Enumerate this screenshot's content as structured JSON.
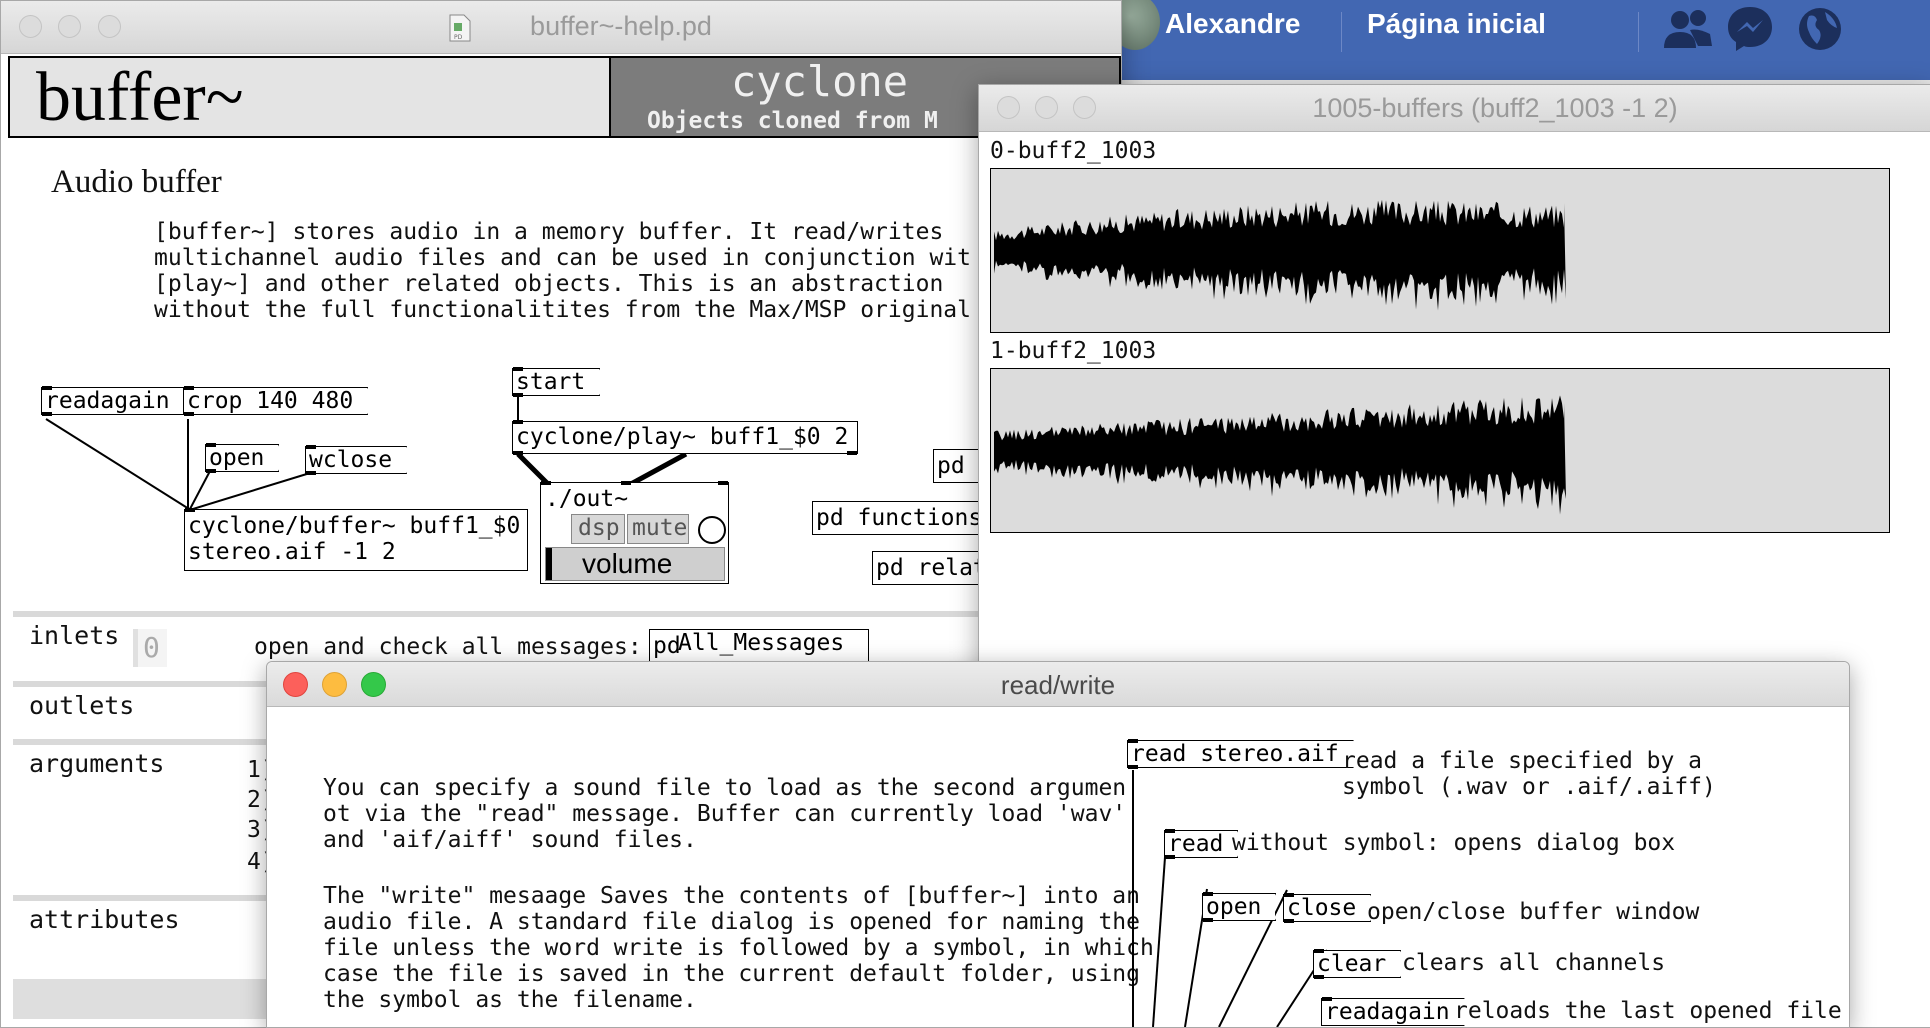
{
  "facebook": {
    "user_name": "Alexandre",
    "home_label": "Página inicial",
    "icons": [
      "friends-icon",
      "messenger-icon",
      "globe-icon"
    ],
    "color": "#4267b2"
  },
  "help_window": {
    "title": "buffer~-help.pd",
    "header_name": "buffer~",
    "header_lib": "cyclone",
    "header_lib_sub": "Objects cloned from M",
    "section_title": "Audio buffer",
    "description": "[buffer~] stores audio in a memory buffer. It read/writes\nmultichannel audio files and can be used in conjunction wit\n[play~] and other related objects. This is an abstraction\nwithout the full functionalitites from the Max/MSP original",
    "objects": {
      "readagain": "readagain",
      "crop": "crop 140 480",
      "open": "open",
      "wclose": "wclose",
      "start": "start",
      "play": "cyclone/play~ buff1_$0 2",
      "out": "./out~",
      "dsp": "dsp",
      "mute": "mute",
      "volume": "volume",
      "buffer": "cyclone/buffer~ buff1_$0\nstereo.aif -1 2",
      "pd_main": "pd",
      "pd_functions": "pd functions",
      "pd_related": "pd relat"
    },
    "sections": {
      "inlets": "inlets",
      "inlets_num": "0",
      "open_check": "open and check all messages:",
      "all_messages": "All_Messages",
      "all_messages_prefix": "pd",
      "outlets": "outlets",
      "arguments": "arguments",
      "arg_nums": [
        "1)",
        "2)",
        "3)",
        "4)"
      ],
      "attributes": "attributes"
    }
  },
  "buffers_window": {
    "title": "1005-buffers (buff2_1003 -1 2)",
    "channels": [
      {
        "label": "0-buff2_1003"
      },
      {
        "label": "1-buff2_1003"
      }
    ]
  },
  "rw_window": {
    "title": "read/write",
    "paragraph1": "You can specify a sound file to load as the second argumen\not via the \"read\" message. Buffer can currently load 'wav'\nand 'aif/aiff' sound files.",
    "paragraph2": "The \"write\" mesaage Saves the contents of [buffer~] into an\naudio file. A standard file dialog is opened for naming the\nfile unless the word write is followed by a symbol, in which\ncase the file is saved in the current default folder, using\nthe symbol as the filename.",
    "msgs": {
      "read_stereo": "read stereo.aif",
      "read_stereo_desc": "read a file specified by a\nsymbol (.wav or .aif/.aiff)",
      "read": "read",
      "read_desc": "without symbol: opens dialog box",
      "open": "open",
      "close": "close",
      "open_close_desc": "open/close buffer window",
      "clear": "clear",
      "clear_desc": "clears all channels",
      "readagain": "readagain",
      "readagain_desc": "reloads the last opened file"
    },
    "traffic_colors": [
      "#fc605b",
      "#fdbc40",
      "#34c84a"
    ]
  }
}
